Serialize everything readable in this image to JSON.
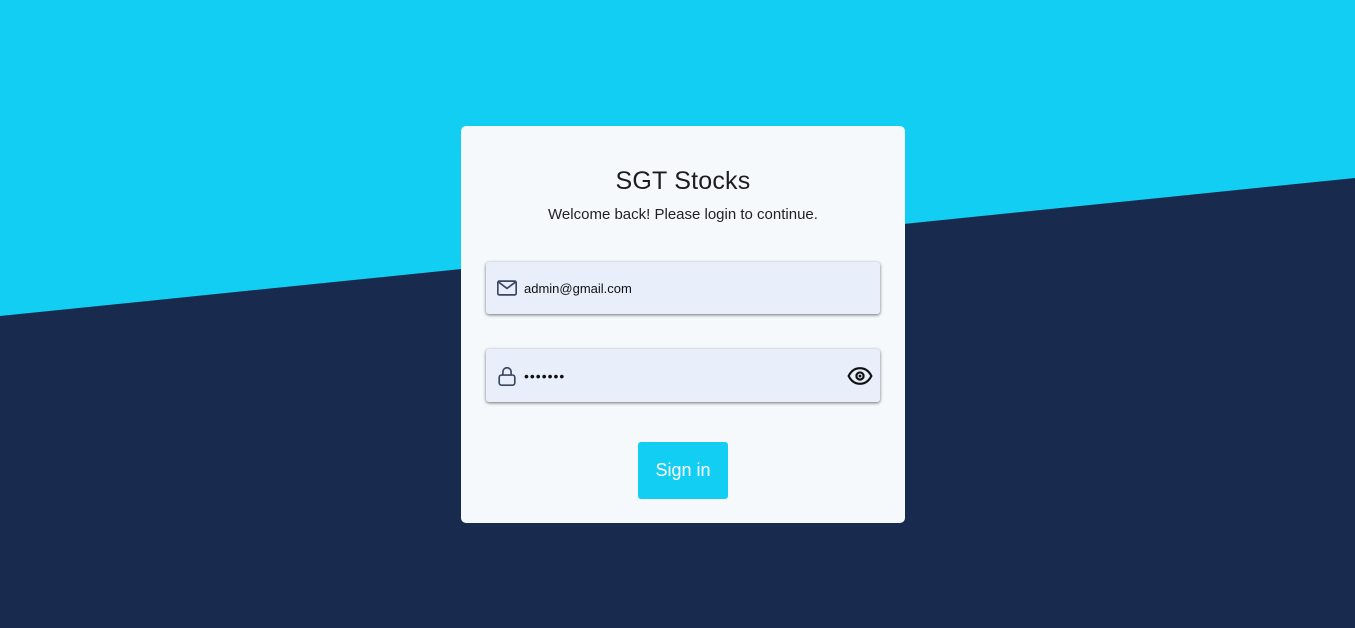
{
  "app": {
    "title": "SGT Stocks",
    "subtitle": "Welcome back! Please login to continue."
  },
  "form": {
    "email": {
      "value": "admin@gmail.com",
      "icon": "mail-icon"
    },
    "password": {
      "value": "•••••••",
      "icon": "lock-icon",
      "toggle_icon": "eye-icon"
    },
    "submit_label": "Sign in"
  },
  "colors": {
    "accent": "#12cef2",
    "background_dark": "#182a4d",
    "card": "#f5f9fc",
    "field": "#e8effb"
  }
}
